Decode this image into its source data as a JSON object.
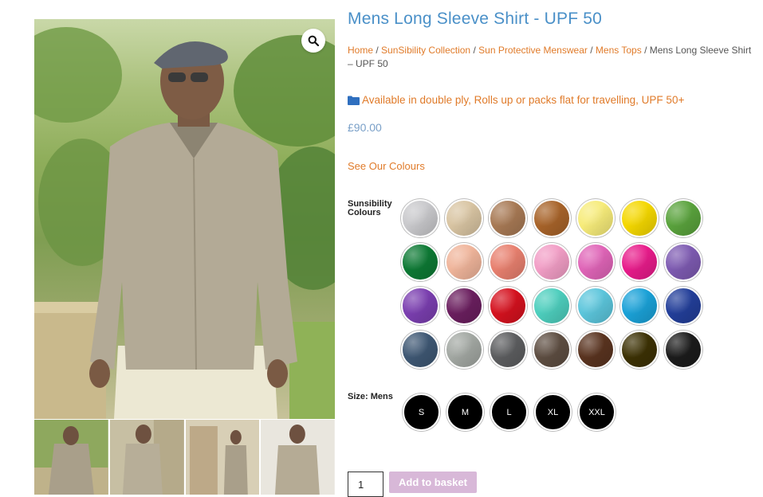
{
  "product": {
    "title": "Mens Long Sleeve Shirt - UPF 50",
    "price": "£90.00",
    "notice": "Available in double ply, Rolls up or packs flat for travelling, UPF 50+",
    "see_colours": "See Our Colours"
  },
  "breadcrumb": {
    "items": [
      "Home",
      "SunSibility Collection",
      "Sun Protective Menswear",
      "Mens Tops"
    ],
    "separator": "/",
    "current": "Mens Long Sleeve Shirt – UPF 50"
  },
  "gallery": {
    "zoom_icon": "search-icon"
  },
  "colours": {
    "label": "Sunsibility Colours",
    "swatches": [
      "#c9c9cc",
      "#d9c5a3",
      "#a87a55",
      "#a8642a",
      "#f7ec7a",
      "#f5d800",
      "#5aa33d",
      "#0e7a35",
      "#f0b59b",
      "#e8806f",
      "#f29ec6",
      "#e065b8",
      "#e81c8b",
      "#7e5bb2",
      "#7b3fb0",
      "#6b1f5f",
      "#d5121f",
      "#4ecfbe",
      "#5cc6dc",
      "#1ba2d8",
      "#233f9a",
      "#3f5874",
      "#a3a8a3",
      "#5d5e60",
      "#5e4e42",
      "#5a3420",
      "#3d3205",
      "#1c1c1c"
    ]
  },
  "size": {
    "label": "Size: Mens",
    "options": [
      "S",
      "M",
      "L",
      "XL",
      "XXL"
    ]
  },
  "cart": {
    "quantity": "1",
    "add_label": "Add to basket"
  }
}
